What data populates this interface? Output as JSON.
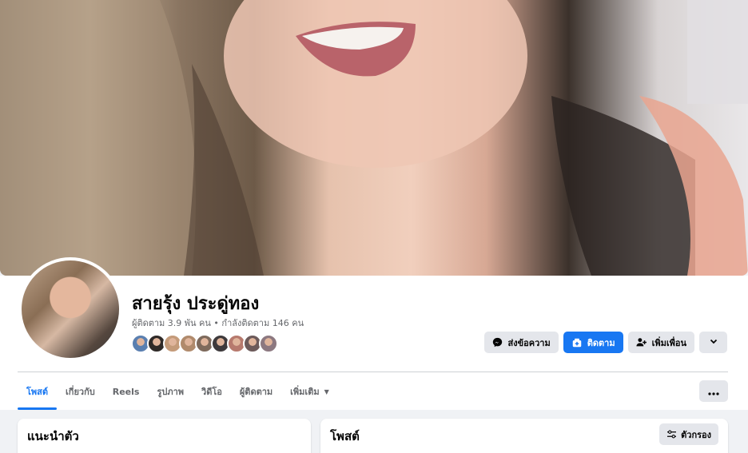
{
  "profile": {
    "name": "สายรุ้ง ประดู่ทอง",
    "stats": "ผู้ติดตาม 3.9 พัน คน • กำลังติดตาม 146 คน",
    "friend_avatar_colors": [
      "#5a7fb0",
      "#2f2a28",
      "#c49b7a",
      "#b08a6c",
      "#7e6a5c",
      "#3e3a3c",
      "#b77a6e",
      "#6c5a5a",
      "#8c7880"
    ]
  },
  "actions": {
    "message_label": "ส่งข้อความ",
    "follow_label": "ติดตาม",
    "add_friend_label": "เพิ่มเพื่อน"
  },
  "tabs": [
    {
      "label": "โพสต์"
    },
    {
      "label": "เกี่ยวกับ"
    },
    {
      "label": "Reels"
    },
    {
      "label": "รูปภาพ"
    },
    {
      "label": "วิดีโอ"
    },
    {
      "label": "ผู้ติดตาม"
    },
    {
      "label": "เพิ่มเติม"
    }
  ],
  "intro": {
    "title": "แนะนำตัว"
  },
  "posts": {
    "title": "โพสต์",
    "filter_label": "ตัวกรอง"
  },
  "colors": {
    "accent": "#1877f2",
    "gray_button": "#e4e6eb",
    "background": "#f0f2f5"
  }
}
